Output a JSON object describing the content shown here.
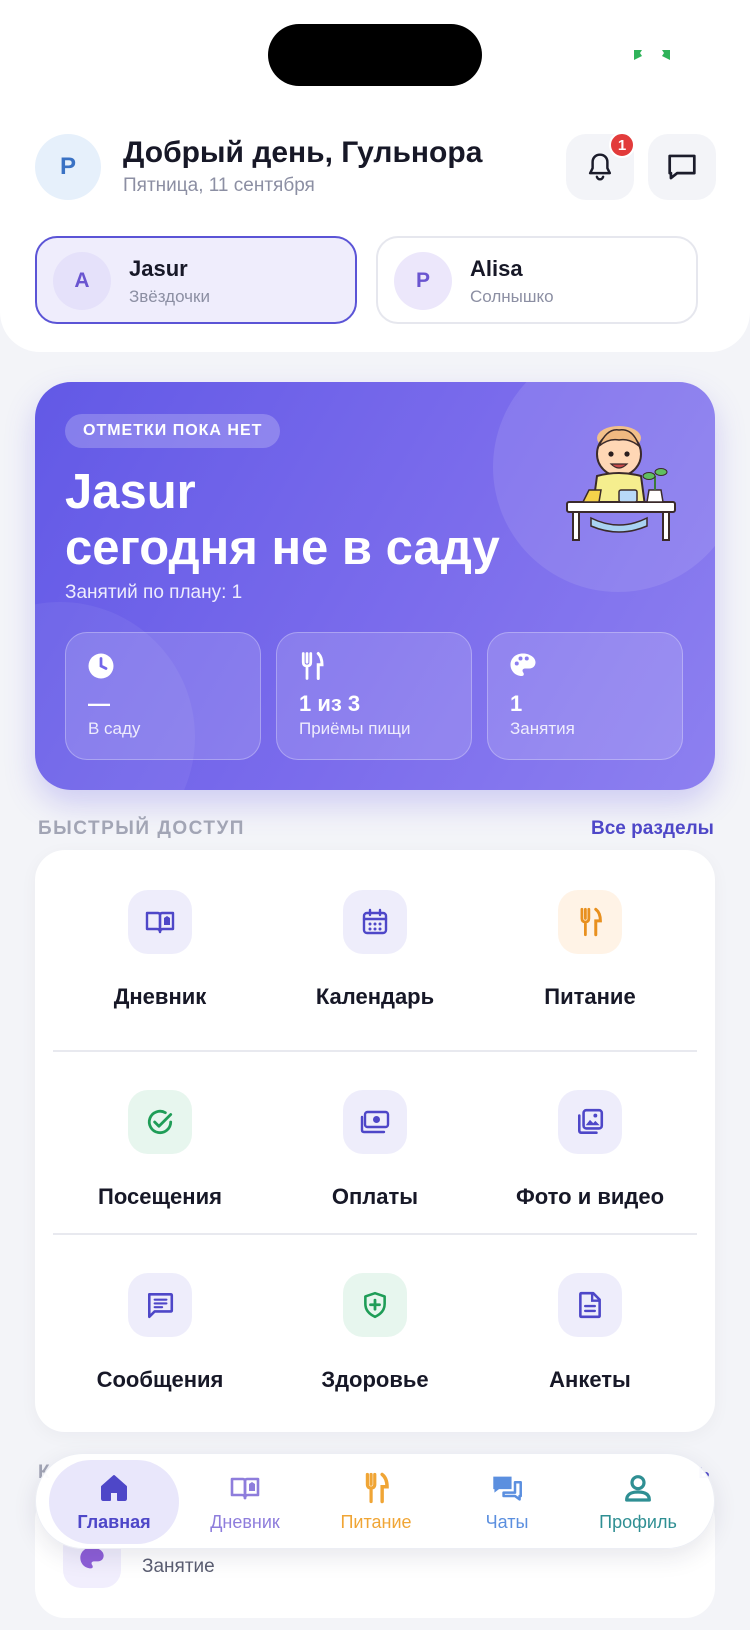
{
  "header": {
    "avatar_initial": "Р",
    "greeting": "Добрый день, Гульнора",
    "date": "Пятница, 11 сентября",
    "notification_count": "1"
  },
  "children": [
    {
      "initial": "A",
      "name": "Jasur",
      "group": "Звёздочки",
      "selected": true
    },
    {
      "initial": "P",
      "name": "Alisa",
      "group": "Солнышко",
      "selected": false
    }
  ],
  "hero": {
    "status_pill": "ОТМЕТКИ ПОКА НЕТ",
    "title_line1": "Jasur",
    "title_line2": "сегодня не в саду",
    "subtitle": "Занятий по плану: 1",
    "stats": [
      {
        "icon": "clock-icon",
        "value": "—",
        "label": "В саду"
      },
      {
        "icon": "utensils-icon",
        "value": "1 из 3",
        "label": "Приёмы пищи"
      },
      {
        "icon": "palette-icon",
        "value": "1",
        "label": "Занятия"
      }
    ]
  },
  "quick_access": {
    "title": "БЫСТРЫЙ ДОСТУП",
    "all_link": "Все разделы",
    "items": [
      {
        "label": "Дневник",
        "icon": "book-icon"
      },
      {
        "label": "Календарь",
        "icon": "calendar-icon"
      },
      {
        "label": "Питание",
        "icon": "utensils-icon"
      },
      {
        "label": "Посещения",
        "icon": "check-circle-icon"
      },
      {
        "label": "Оплаты",
        "icon": "money-icon"
      },
      {
        "label": "Фото и видео",
        "icon": "photo-icon"
      },
      {
        "label": "Сообщения",
        "icon": "message-icon"
      },
      {
        "label": "Здоровье",
        "icon": "shield-plus-icon"
      },
      {
        "label": "Анкеты",
        "icon": "document-icon"
      }
    ]
  },
  "next_section": {
    "title_peek": "К",
    "right_peek": "ь",
    "item_text": "Занятие"
  },
  "tabbar": {
    "items": [
      {
        "label": "Главная",
        "icon": "home-icon",
        "active": true
      },
      {
        "label": "Дневник",
        "icon": "book-icon",
        "active": false
      },
      {
        "label": "Питание",
        "icon": "utensils-icon",
        "active": false
      },
      {
        "label": "Чаты",
        "icon": "chats-icon",
        "active": false
      },
      {
        "label": "Профиль",
        "icon": "user-icon",
        "active": false
      }
    ]
  },
  "colors": {
    "accent": "#5b54d6",
    "hero_gradient_start": "#6259e6",
    "hero_gradient_end": "#8d80f0",
    "badge": "#e23b3b",
    "food_orange": "#f0a535",
    "health_green": "#1f9d57"
  }
}
